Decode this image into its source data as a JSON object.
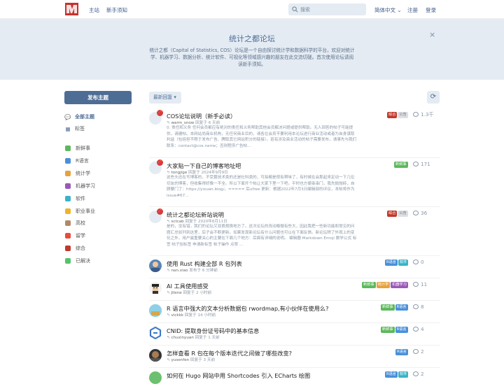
{
  "topbar": {
    "nav": [
      "主站",
      "新手须知"
    ],
    "search_placeholder": "搜索",
    "language": "简体中文 ⌄",
    "register": "注册",
    "login": "登录"
  },
  "hero": {
    "title": "统计之都论坛",
    "description": "统计之都（Capital of Statistics, COS）论坛是一个自由探讨统计学和数据科学的平台，欢迎对统计学、机器学习、数据分析、统计软件、可视化等领域感兴趣的朋友在此交流切磋。首次使用论坛请阅读新手须知。",
    "close": "×"
  },
  "sidebar": {
    "new_topic": "发布主题",
    "all_topics": "全部主题",
    "tags_label": "标签",
    "categories": [
      {
        "label": "新鲜事",
        "color": "#5cb85c"
      },
      {
        "label": "R语言",
        "color": "#4a90d9"
      },
      {
        "label": "统计学",
        "color": "#e6a23c"
      },
      {
        "label": "机器学习",
        "color": "#9b59b6"
      },
      {
        "label": "软件",
        "color": "#3bb2c9"
      },
      {
        "label": "职业事业",
        "color": "#f0b429"
      },
      {
        "label": "高校",
        "color": "#b08968"
      },
      {
        "label": "留学",
        "color": "#e74c3c"
      },
      {
        "label": "综合",
        "color": "#c0392b"
      },
      {
        "label": "已解决",
        "color": "#57c26b"
      }
    ]
  },
  "toolbar": {
    "sort": "最新回复 ▾",
    "refresh_icon": "refresh-icon"
  },
  "colors": {
    "accent": "#4d6d94",
    "hero_bg": "#e4ebf3"
  },
  "discussions": [
    {
      "title": "COS论坛说明（新手必读）",
      "author": "warm_snow",
      "meta": "回复于 6 天前",
      "excerpt": "0. 责任和义务 任何会员都应有绝对的责任和义务帮助其他会员解决问题或提供帮助。无人回答的帖子可能提供，请建帖。本网站尚商业机构，无任何商业目的，请各位会员不要利用本论坛进行商业活动或者为自身谋取利益（包括但不限于发布广告、腾取其它网站积分的链接）。若有涉及商业活动的帖子需要发布，请事先与我们联系：contact@cos.name；否则程序广告帖...",
      "tags": [
        {
          "label": "综合",
          "color": "#c0392b"
        },
        {
          "label": "公告",
          "color": "#dcdfe4",
          "text": "#777"
        }
      ],
      "replies": "1.3千",
      "pinned": true
    },
    {
      "title": "大家贴一下自己的博客地址吧",
      "author": "tongjige",
      "meta": "回复于 2024年9月9日",
      "excerpt": "这些头还在写博客的，不受篇技术类的还是社科类的，可拍都是很有帮味了，有时候在会那起来定动一下几位切友的博客，但收集得好像一不全。所以下面开个帖让大家下里一下吧。平时也方便串串门，我先抛抛砖，自顾要门了：https://yixuan.blog/。===== 后ufree 更新：根据2022年7月3日编辑部的评议，本帖将作为 issue#67...",
      "tags": [
        {
          "label": "新鲜事",
          "color": "#5cb85c"
        }
      ],
      "replies": "171",
      "pinned": true
    },
    {
      "title": "统计之都论坛新站说明",
      "author": "sctcab",
      "meta": "回复于 2020年6月11日",
      "excerpt": "是的，没有错，我们的论坛又双叒叕换地方了。这次论坛的改动略微有些大，因此我把一些新功能和常见的问题汇总如列到这里，后子会不断更新。如果发现新论坛有什么问题也可以在下面反馈。新论坛除了外观上的变化之外，用户最重要关心的主要在下面几个地方：后面有详细的说明。 编辑器 Markdown Emoji 数学公式 标签 帖子加标签 申请新标签 帖子操作 点赞 ...",
      "tags": [
        {
          "label": "综合",
          "color": "#c0392b"
        },
        {
          "label": "公告",
          "color": "#dcdfe4",
          "text": "#777"
        }
      ],
      "replies": "36",
      "pinned": true
    },
    {
      "title": "使用 Rust 构建全部 R 包列表",
      "author": "nan.xiao",
      "meta": "发布于 6 分钟前",
      "tags": [
        {
          "label": "R语言",
          "color": "#4a90d9"
        },
        {
          "label": "软件",
          "color": "#3bb2c9"
        }
      ],
      "replies": "0"
    },
    {
      "title": "AI 工具使用感受",
      "author": "Jilene",
      "meta": "回复于 2 小时前",
      "tags": [
        {
          "label": "新鲜事",
          "color": "#5cb85c"
        },
        {
          "label": "统计学",
          "color": "#e6a23c"
        },
        {
          "label": "机器学习",
          "color": "#9b59b6"
        }
      ],
      "replies": "11"
    },
    {
      "title": "R 语言中强大的文本分析数据包 rwordmap,有小伙伴在使用么?",
      "author": "vickkk",
      "meta": "回复于 14 小时前",
      "tags": [
        {
          "label": "新鲜事",
          "color": "#5cb85c"
        },
        {
          "label": "R语言",
          "color": "#4a90d9"
        }
      ],
      "replies": "8"
    },
    {
      "title": "CNID: 提取身份证号码中的基本信息",
      "author": "chuxinyuan",
      "meta": "回复于 1 天前",
      "tags": [
        {
          "label": "新鲜事",
          "color": "#5cb85c"
        },
        {
          "label": "R语言",
          "color": "#4a90d9"
        }
      ],
      "replies": "4"
    },
    {
      "title": "怎样查看 R 包在每个版本迭代之间做了哪些改变?",
      "author": "yusenfen",
      "meta": "回复于 3 天前",
      "tags": [
        {
          "label": "R语言",
          "color": "#4a90d9"
        }
      ],
      "replies": "2"
    },
    {
      "title": "如何在 Hugo 网站中用 Shortcodes 引入 ECharts 绘图",
      "author": "",
      "meta": "",
      "tags": [
        {
          "label": "R语言",
          "color": "#4a90d9"
        },
        {
          "label": "软件",
          "color": "#3bb2c9"
        }
      ],
      "replies": "2"
    }
  ]
}
